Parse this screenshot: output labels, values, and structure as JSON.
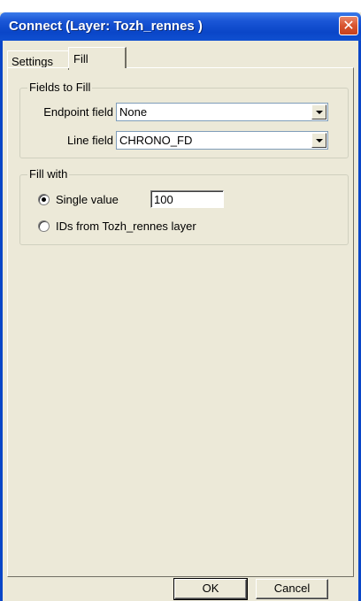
{
  "window": {
    "title": "Connect (Layer: Tozh_rennes )",
    "close_glyph": "✕"
  },
  "tabs": [
    {
      "label": "Settings",
      "active": false
    },
    {
      "label": "Fill",
      "active": true
    }
  ],
  "fields_to_fill": {
    "legend": "Fields to Fill",
    "endpoint_label": "Endpoint field",
    "endpoint_value": "None",
    "line_label": "Line field",
    "line_value": "CHRONO_FD"
  },
  "fill_with": {
    "legend": "Fill with",
    "single_value_label": "Single value",
    "single_value_selected": true,
    "single_value_input": "100",
    "ids_label": "IDs from Tozh_rennes layer",
    "ids_selected": false
  },
  "buttons": {
    "ok": "OK",
    "cancel": "Cancel"
  },
  "colors": {
    "titlebar": "#0a46c8",
    "dialog_bg": "#ece9d8",
    "close_button": "#d8542f"
  },
  "icons": {
    "close": "close-icon",
    "dropdown": "chevron-down-icon"
  }
}
